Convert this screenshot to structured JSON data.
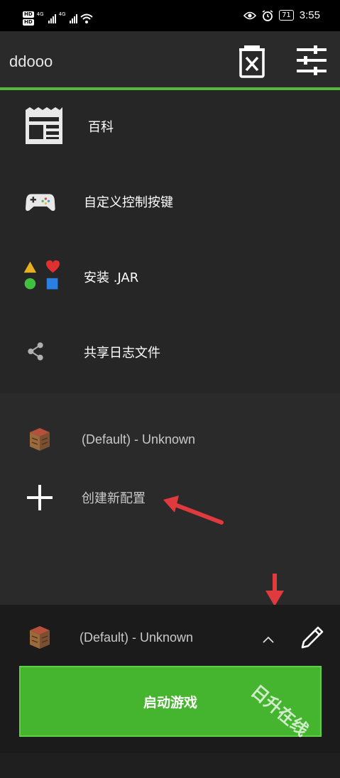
{
  "status_bar": {
    "hd_badge": "HD",
    "network_label": "4G",
    "battery": "71",
    "time": "3:55"
  },
  "top_bar": {
    "profile_name": "ddooo"
  },
  "menu": {
    "items": [
      {
        "label": "百科",
        "icon": "newspaper-icon"
      },
      {
        "label": "自定义控制按键",
        "icon": "gamepad-icon"
      },
      {
        "label": "安装 .JAR",
        "icon": "shapes-icon"
      },
      {
        "label": "共享日志文件",
        "icon": "share-icon"
      }
    ]
  },
  "profiles": {
    "items": [
      {
        "label": "(Default) - Unknown",
        "icon": "crafting-table-icon"
      },
      {
        "label": "创建新配置",
        "icon": "plus-icon"
      }
    ]
  },
  "bottom_bar": {
    "selected_profile": "(Default) - Unknown",
    "launch_label": "启动游戏"
  },
  "watermark": "日升在线",
  "colors": {
    "accent_green": "#45b52f",
    "annotation_red": "#e03a3e",
    "background": "#1f1f1f"
  }
}
